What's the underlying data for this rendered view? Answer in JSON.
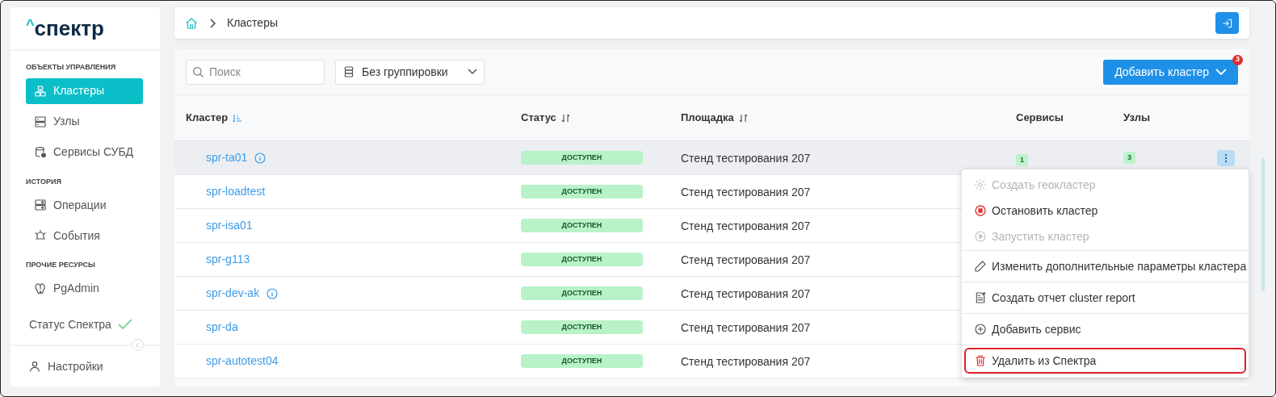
{
  "logo": {
    "caret": "^",
    "text": "спектр"
  },
  "sidebar": {
    "sections": [
      {
        "title": "ОБЪЕКТЫ УПРАВЛЕНИЯ",
        "items": [
          {
            "label": "Кластеры",
            "selected": true
          },
          {
            "label": "Узлы",
            "selected": false
          },
          {
            "label": "Сервисы СУБД",
            "selected": false
          }
        ]
      },
      {
        "title": "ИСТОРИЯ",
        "items": [
          {
            "label": "Операции",
            "selected": false
          },
          {
            "label": "События",
            "selected": false
          }
        ]
      },
      {
        "title": "ПРОЧИЕ РЕСУРСЫ",
        "items": [
          {
            "label": "PgAdmin",
            "selected": false
          }
        ]
      }
    ],
    "status": {
      "label": "Статус Спектра",
      "ok": true
    },
    "settings": "Настройки"
  },
  "breadcrumb": [
    "Кластеры"
  ],
  "toolbar": {
    "search": {
      "placeholder": "Поиск"
    },
    "grouping": "Без группировки",
    "add_button": "Добавить кластер",
    "badge": "3"
  },
  "table": {
    "columns": [
      {
        "label": "Кластер",
        "sorted": true
      },
      {
        "label": "Статус",
        "sorted": false
      },
      {
        "label": "Площадка",
        "sorted": false
      },
      {
        "label": "Сервисы"
      },
      {
        "label": "Узлы"
      }
    ],
    "rows": [
      {
        "name": "spr-ta01",
        "info": true,
        "status": "ДОСТУПЕН",
        "site": "Стенд тестирования 207",
        "services": "1",
        "nodes": "3",
        "selected": true
      },
      {
        "name": "spr-loadtest",
        "info": false,
        "status": "ДОСТУПЕН",
        "site": "Стенд тестирования 207",
        "selected": false
      },
      {
        "name": "spr-isa01",
        "info": false,
        "status": "ДОСТУПЕН",
        "site": "Стенд тестирования 207",
        "selected": false
      },
      {
        "name": "spr-g113",
        "info": false,
        "status": "ДОСТУПЕН",
        "site": "Стенд тестирования 207",
        "selected": false
      },
      {
        "name": "spr-dev-ak",
        "info": true,
        "status": "ДОСТУПЕН",
        "site": "Стенд тестирования 207",
        "selected": false
      },
      {
        "name": "spr-da",
        "info": false,
        "status": "ДОСТУПЕН",
        "site": "Стенд тестирования 207",
        "selected": false
      },
      {
        "name": "spr-autotest04",
        "info": false,
        "status": "ДОСТУПЕН",
        "site": "Стенд тестирования 207",
        "selected": false
      }
    ]
  },
  "menu": {
    "sections": [
      [
        {
          "label": "Создать геокластер",
          "disabled": true,
          "highlighted": false
        },
        {
          "label": "Остановить кластер",
          "disabled": false,
          "highlighted": false
        },
        {
          "label": "Запустить кластер",
          "disabled": true,
          "highlighted": false
        }
      ],
      [
        {
          "label": "Изменить дополнительные параметры кластера",
          "disabled": false,
          "highlighted": false
        }
      ],
      [
        {
          "label": "Создать отчет cluster report",
          "disabled": false,
          "highlighted": false
        }
      ],
      [
        {
          "label": "Добавить сервис",
          "disabled": false,
          "highlighted": false
        }
      ],
      [
        {
          "label": "Удалить из Спектра",
          "disabled": false,
          "highlighted": true
        }
      ]
    ]
  }
}
